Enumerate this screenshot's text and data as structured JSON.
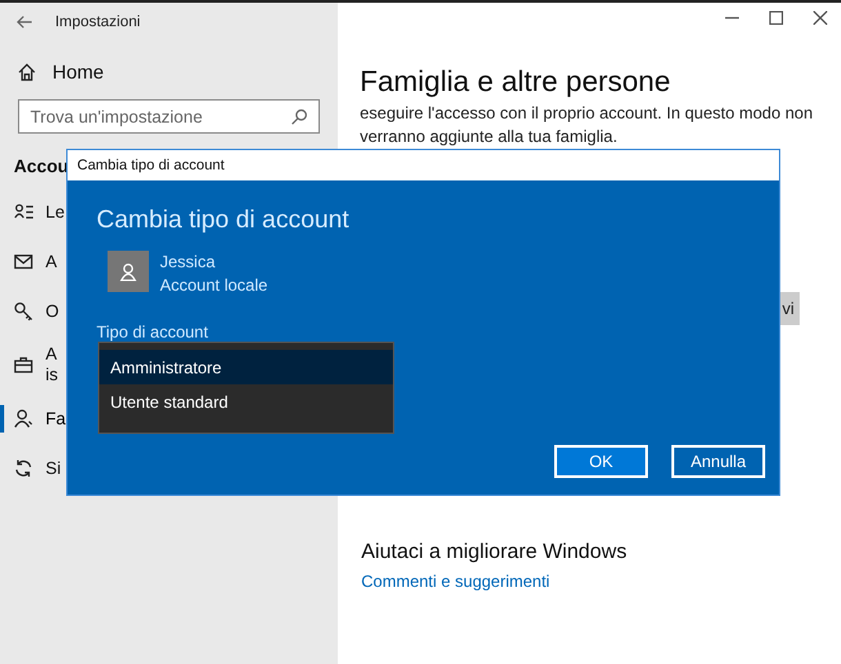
{
  "window": {
    "title": "Impostazioni"
  },
  "sidebar": {
    "home": "Home",
    "search": {
      "placeholder": "Trova un'impostazione"
    },
    "section": "Accou",
    "items": [
      {
        "lines": [
          "Le"
        ],
        "selected": false
      },
      {
        "lines": [
          "A"
        ],
        "selected": false
      },
      {
        "lines": [
          "O"
        ],
        "selected": false
      },
      {
        "lines": [
          "A",
          "is"
        ],
        "selected": false
      },
      {
        "lines": [
          "Fa"
        ],
        "selected": true
      },
      {
        "lines": [
          "Si"
        ],
        "selected": false
      }
    ]
  },
  "content": {
    "heading": "Famiglia e altre persone",
    "paragraph_lines": [
      "eseguire l'accesso con il proprio account. In questo modo non",
      "verranno aggiunte alla tua famiglia."
    ],
    "partial_button": "vi",
    "help_heading": "Aiutaci a migliorare Windows",
    "help_link": "Commenti e suggerimenti"
  },
  "dialog": {
    "title": "Cambia tipo di account",
    "heading": "Cambia tipo di account",
    "user": {
      "name": "Jessica",
      "type": "Account locale"
    },
    "field_label": "Tipo di account",
    "options": [
      {
        "label": "Amministratore",
        "selected": true
      },
      {
        "label": "Utente standard",
        "selected": false
      }
    ],
    "buttons": [
      {
        "label": "OK",
        "kind": "primary"
      },
      {
        "label": "Annulla",
        "kind": "secondary"
      }
    ]
  }
}
